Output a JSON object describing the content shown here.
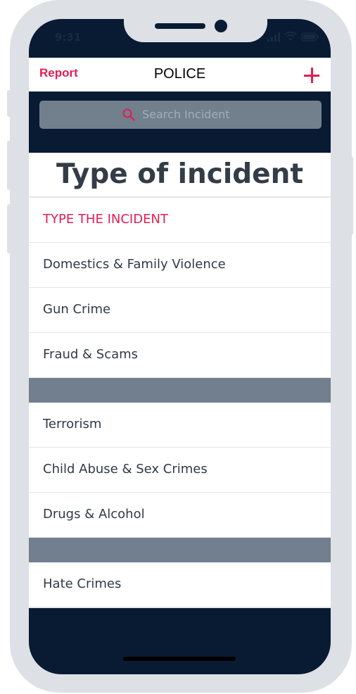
{
  "status_bar": {
    "time": "9:31"
  },
  "navbar": {
    "left_label": "Report",
    "title": "POLICE",
    "add_icon": "plus-icon"
  },
  "search": {
    "placeholder": "Search Incident",
    "icon": "search-icon"
  },
  "page": {
    "title": "Type of incident"
  },
  "list": {
    "header": "TYPE THE INCIDENT",
    "items": [
      "Domestics & Family Violence",
      "Gun Crime",
      "Fraud & Scams",
      "Terrorism",
      "Child Abuse & Sex Crimes",
      "Drugs & Alcohol",
      "Hate Crimes"
    ]
  },
  "colors": {
    "accent": "#e01e53",
    "dark_navy": "#081b33",
    "section_band": "#717f8e",
    "search_box": "#727f8d",
    "frame": "#dde0e5"
  }
}
